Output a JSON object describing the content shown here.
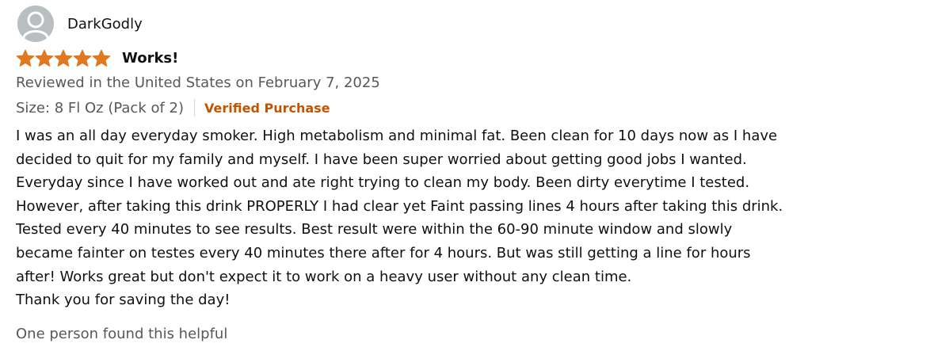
{
  "reviewer": {
    "name": "DarkGodly",
    "avatar_icon": "default-avatar-icon"
  },
  "review": {
    "rating": 5,
    "rating_max": 5,
    "star_color": "#de7921",
    "title": "Works!",
    "date_text": "Reviewed in the United States on February 7, 2025",
    "variant_text": "Size: 8 Fl Oz (Pack of 2)",
    "verified_label": "Verified Purchase",
    "verified_color": "#c45500",
    "body_lines": [
      "I was an all day everyday smoker. High metabolism and minimal fat. Been clean for 10 days now as I have",
      "decided to quit for my family and myself. I have been super worried about getting good jobs I wanted.",
      "Everyday since I have worked out and ate right trying to clean my body. Been dirty everytime I tested.",
      "However, after taking this drink PROPERLY I had clear yet Faint passing lines 4 hours after taking this drink.",
      "Tested every 40 minutes to see results. Best result were within the 60-90 minute window and slowly",
      "became fainter on testes every 40 minutes there after for 4 hours. But was still getting a line for hours",
      "after! Works great but don't expect it to work on a heavy user without any clean time.",
      "Thank you for saving the day!"
    ],
    "helpful_text": "One person found this helpful"
  }
}
